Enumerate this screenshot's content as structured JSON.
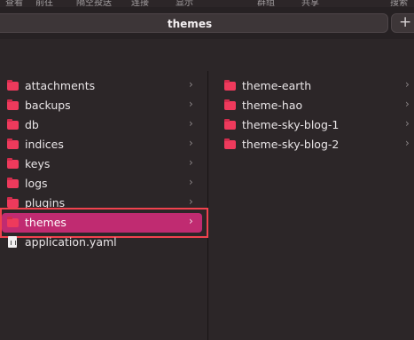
{
  "toolbar": {
    "items": [
      "查看",
      "前往",
      "隔空投送",
      "连接",
      "显示",
      "群组",
      "共享",
      "搜索"
    ]
  },
  "tab": {
    "title": "themes",
    "add_label": "+"
  },
  "left_column": {
    "items": [
      {
        "label": "attachments",
        "type": "folder",
        "has_children": true
      },
      {
        "label": "backups",
        "type": "folder",
        "has_children": true
      },
      {
        "label": "db",
        "type": "folder",
        "has_children": true
      },
      {
        "label": "indices",
        "type": "folder",
        "has_children": true
      },
      {
        "label": "keys",
        "type": "folder",
        "has_children": true
      },
      {
        "label": "logs",
        "type": "folder",
        "has_children": true
      },
      {
        "label": "plugins",
        "type": "folder",
        "has_children": true
      },
      {
        "label": "themes",
        "type": "folder",
        "has_children": true,
        "selected": true
      },
      {
        "label": "application.yaml",
        "type": "file",
        "has_children": false
      }
    ]
  },
  "right_column": {
    "items": [
      {
        "label": "theme-earth",
        "type": "folder",
        "has_children": true
      },
      {
        "label": "theme-hao",
        "type": "folder",
        "has_children": true
      },
      {
        "label": "theme-sky-blog-1",
        "type": "folder",
        "has_children": true
      },
      {
        "label": "theme-sky-blog-2",
        "type": "folder",
        "has_children": true
      }
    ]
  },
  "chevron": "›",
  "colors": {
    "folder": "#ee3a5c",
    "selection": "#c02b71",
    "highlight_border": "#f0424e",
    "background": "#2c2628"
  }
}
